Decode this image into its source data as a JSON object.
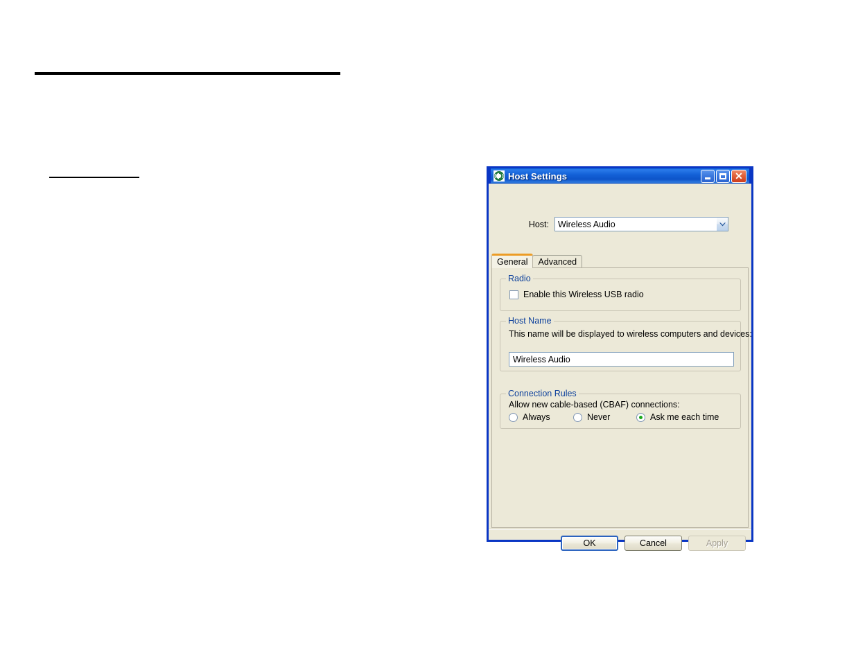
{
  "page": {
    "background": "#ffffff",
    "rules": [
      {
        "name": "top-heading-rule"
      },
      {
        "name": "section-rule"
      }
    ]
  },
  "dialog": {
    "title": "Host Settings",
    "icon": "wireless-usb-logo-icon",
    "accent_color": "#0a36c4",
    "face_color": "#ece9d8",
    "window_buttons": [
      {
        "name": "minimize",
        "glyph": "minimize-icon"
      },
      {
        "name": "maximize",
        "glyph": "maximize-icon"
      },
      {
        "name": "close",
        "glyph": "close-icon",
        "color": "#cc3c1c"
      }
    ],
    "host": {
      "label": "Host:",
      "selected": "Wireless Audio",
      "options": [
        "Wireless Audio"
      ],
      "arrow_icon": "chevron-down-icon"
    },
    "tabs": [
      {
        "label": "General",
        "selected": true
      },
      {
        "label": "Advanced",
        "selected": false
      }
    ],
    "tab_selected_color": "#ec9c26",
    "groups": {
      "radio": {
        "title": "Radio",
        "checkbox": {
          "label": "Enable this Wireless USB radio",
          "checked": false
        }
      },
      "host_name": {
        "title": "Host Name",
        "hint": "This name will be displayed to wireless computers and devices:",
        "value": "Wireless Audio",
        "placeholder": ""
      },
      "connection_rules": {
        "title": "Connection Rules",
        "hint": "Allow new cable-based (CBAF) connections:",
        "options": [
          {
            "label": "Always",
            "selected": false
          },
          {
            "label": "Never",
            "selected": false
          },
          {
            "label": "Ask me each time",
            "selected": true
          }
        ],
        "selected_dot_color": "#1aa81a"
      }
    },
    "buttons": [
      {
        "label": "OK",
        "state": "default"
      },
      {
        "label": "Cancel",
        "state": "normal"
      },
      {
        "label": "Apply",
        "state": "disabled"
      }
    ],
    "group_title_color": "#0b3f9b"
  }
}
